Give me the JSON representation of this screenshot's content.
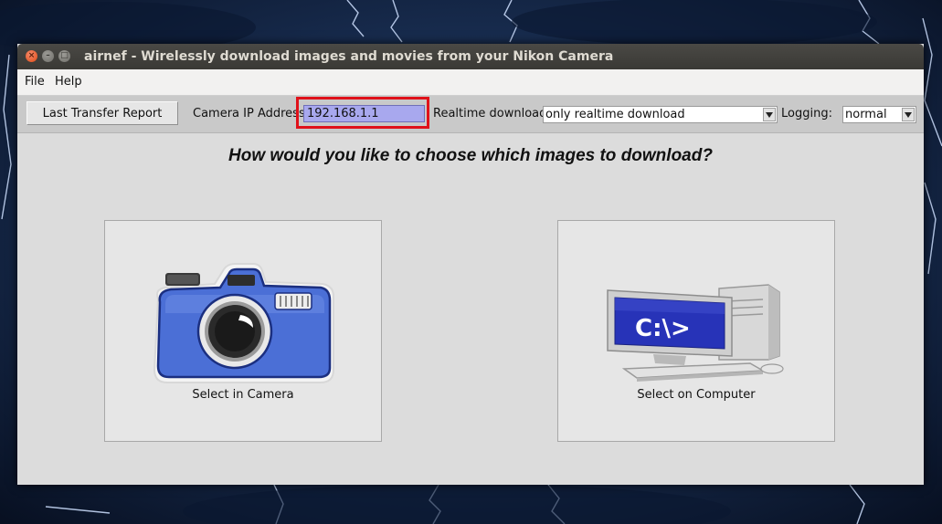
{
  "window": {
    "title": "airnef - Wirelessly download images and movies from your Nikon Camera"
  },
  "menu": {
    "items": [
      "File",
      "Help"
    ]
  },
  "toolbar": {
    "last_transfer_button": "Last Transfer Report",
    "camera_ip_label": "Camera IP Address:",
    "camera_ip_value": "192.168.1.1",
    "realtime_label": "Realtime download:",
    "realtime_value": "only realtime download",
    "logging_label": "Logging:",
    "logging_value": "normal"
  },
  "main": {
    "question": "How would you like to choose which images to download?",
    "choices": [
      {
        "label": "Select in Camera",
        "icon": "camera-icon"
      },
      {
        "label": "Select on Computer",
        "icon": "computer-icon",
        "screen_text": "C:\\>"
      }
    ]
  },
  "colors": {
    "highlight": "#e0111a",
    "ip_field_bg": "#a8a8ee",
    "camera_blue": "#4b6fd6",
    "computer_screen": "#2733b8"
  }
}
